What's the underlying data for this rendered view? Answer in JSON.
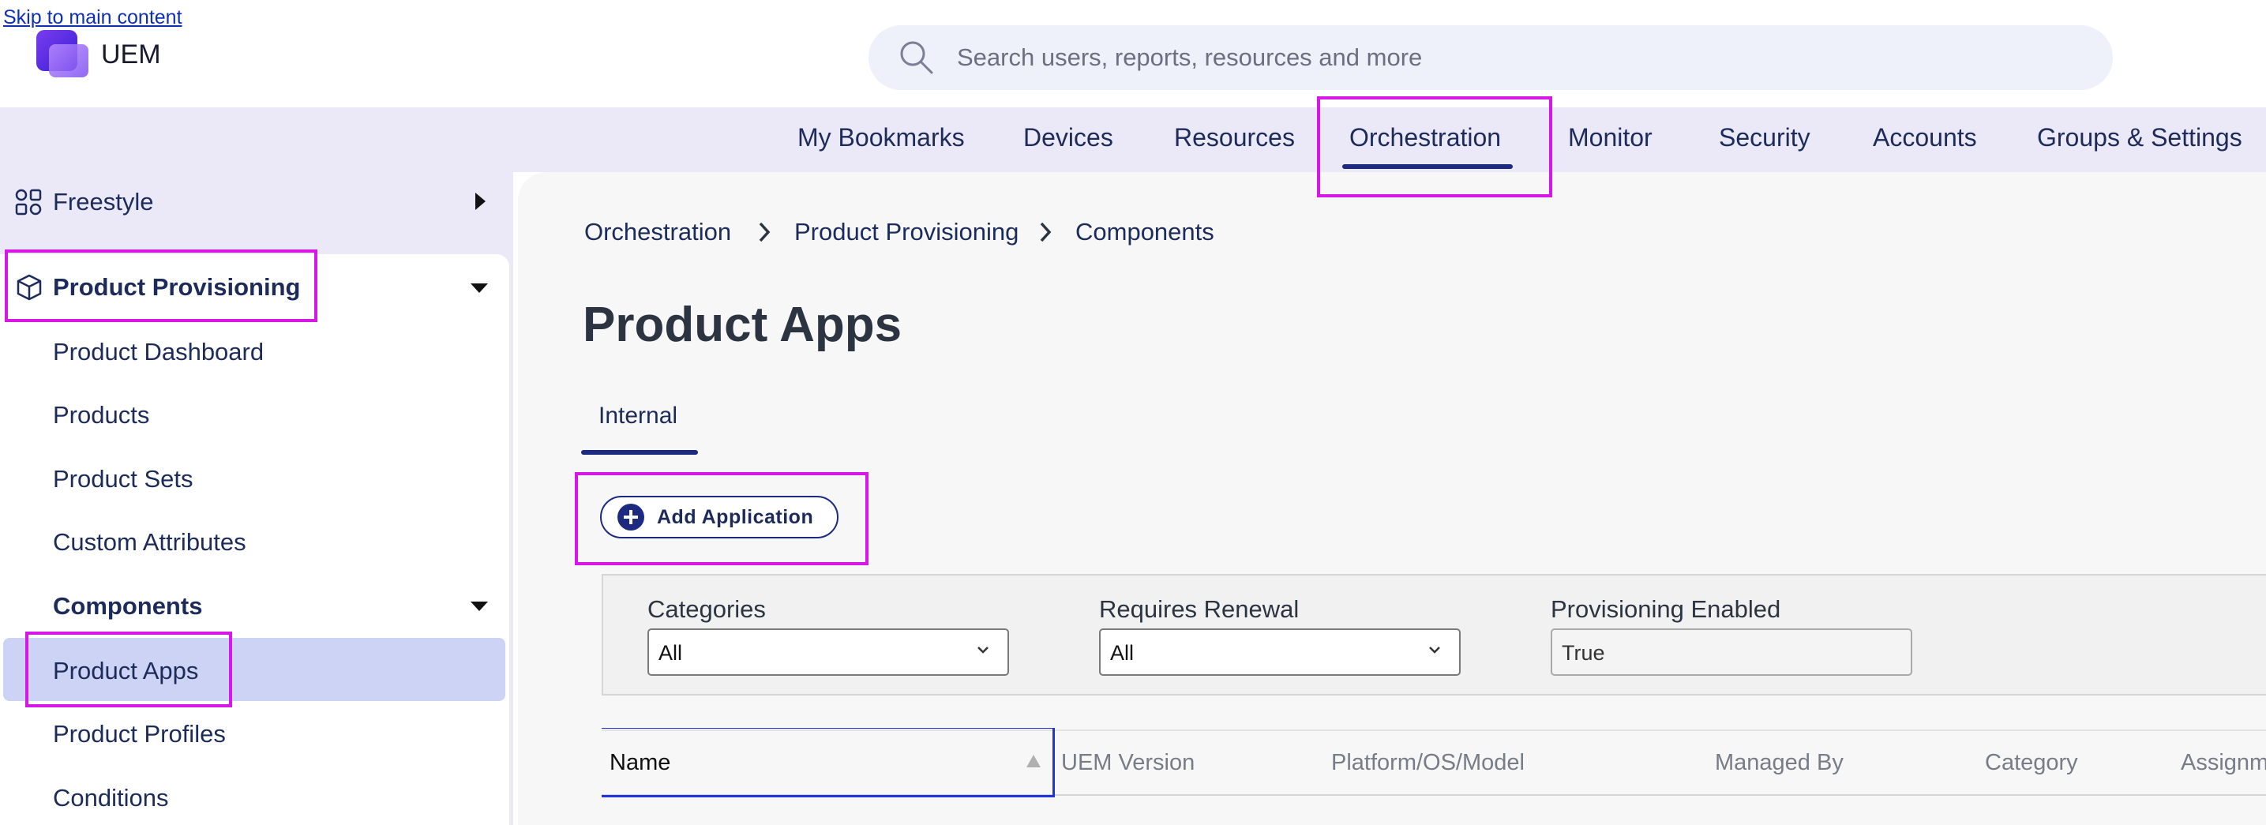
{
  "skip_link": "Skip to main content",
  "brand": {
    "name": "UEM"
  },
  "search": {
    "placeholder": "Search users, reports, resources and more"
  },
  "topnav": {
    "items": [
      "My Bookmarks",
      "Devices",
      "Resources",
      "Orchestration",
      "Monitor",
      "Security",
      "Accounts",
      "Groups & Settings"
    ],
    "active": "Orchestration"
  },
  "sidebar": {
    "freestyle": "Freestyle",
    "product_provisioning": "Product Provisioning",
    "items": [
      "Product Dashboard",
      "Products",
      "Product Sets",
      "Custom Attributes"
    ],
    "components": "Components",
    "component_items": [
      "Product Apps",
      "Product Profiles",
      "Conditions"
    ],
    "selected": "Product Apps"
  },
  "breadcrumb": [
    "Orchestration",
    "Product Provisioning",
    "Components"
  ],
  "page_title": "Product Apps",
  "tabs": [
    "Internal"
  ],
  "add_button": "Add Application",
  "filters": {
    "categories": {
      "label": "Categories",
      "value": "All"
    },
    "requires_renewal": {
      "label": "Requires Renewal",
      "value": "All"
    },
    "provisioning_enabled": {
      "label": "Provisioning Enabled",
      "value": "True"
    }
  },
  "table": {
    "columns": [
      "Name",
      "UEM Version",
      "Platform/OS/Model",
      "Managed By",
      "Category",
      "Assignm"
    ]
  },
  "colors": {
    "accent": "#1c2b80",
    "nav_bg": "#ebe9f7",
    "selected_bg": "#ccd3f4",
    "highlight": "#d617e6"
  }
}
